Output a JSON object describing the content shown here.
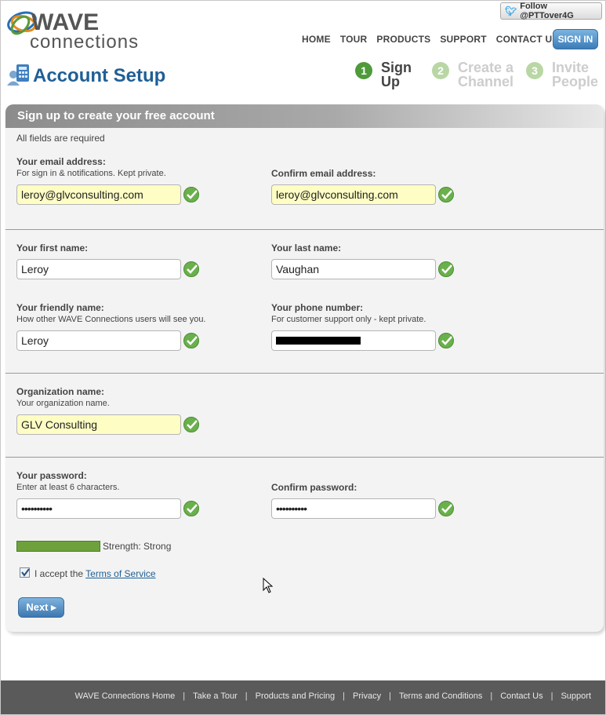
{
  "brand": {
    "logo_wave": "WAVE",
    "logo_connections": "connections"
  },
  "header": {
    "follow_label": "Follow @PTTover4G",
    "nav": [
      "HOME",
      "TOUR",
      "PRODUCTS",
      "SUPPORT",
      "CONTACT US"
    ],
    "signin_label": "SIGN IN"
  },
  "page_title": "Account Setup",
  "steps": [
    {
      "num": "1",
      "label_line1": "Sign",
      "label_line2": "Up",
      "state": "active"
    },
    {
      "num": "2",
      "label_line1": "Create a",
      "label_line2": "Channel",
      "state": "inactive"
    },
    {
      "num": "3",
      "label_line1": "Invite",
      "label_line2": "People",
      "state": "inactive"
    }
  ],
  "form": {
    "heading": "Sign up to create your free account",
    "required_note": "All fields are required",
    "email": {
      "label": "Your email address:",
      "hint": "For sign in & notifications. Kept private.",
      "value": "leroy@glvconsulting.com"
    },
    "confirm_email": {
      "label": "Confirm email address:",
      "value": "leroy@glvconsulting.com"
    },
    "first_name": {
      "label": "Your first name:",
      "value": "Leroy"
    },
    "last_name": {
      "label": "Your last name:",
      "value": "Vaughan"
    },
    "friendly_name": {
      "label": "Your friendly name:",
      "hint": "How other WAVE Connections users will see you.",
      "value": "Leroy"
    },
    "phone": {
      "label": "Your phone number:",
      "hint": "For customer support only - kept private.",
      "value": ""
    },
    "organization": {
      "label": "Organization name:",
      "hint": "Your organization name.",
      "value": "GLV Consulting"
    },
    "password": {
      "label": "Your password:",
      "hint": "Enter at least 6 characters.",
      "value": "••••••••••"
    },
    "confirm_password": {
      "label": "Confirm password:",
      "value": "••••••••••"
    },
    "strength_text": "Strength: Strong",
    "strength_level": 1.0,
    "tos_prefix": "I accept the",
    "tos_link": "Terms of Service",
    "tos_checked": true,
    "next_label": "Next ▸"
  },
  "footer": {
    "links": [
      "WAVE Connections Home",
      "Take a Tour",
      "Products and Pricing",
      "Privacy",
      "Terms and Conditions",
      "Contact Us",
      "Support"
    ]
  },
  "colors": {
    "accent_blue": "#1f5f96",
    "success_green": "#6ab04c",
    "step_active": "#4f9a3b",
    "step_inactive": "#b9d7a4",
    "field_highlight": "#fdfdc4"
  }
}
